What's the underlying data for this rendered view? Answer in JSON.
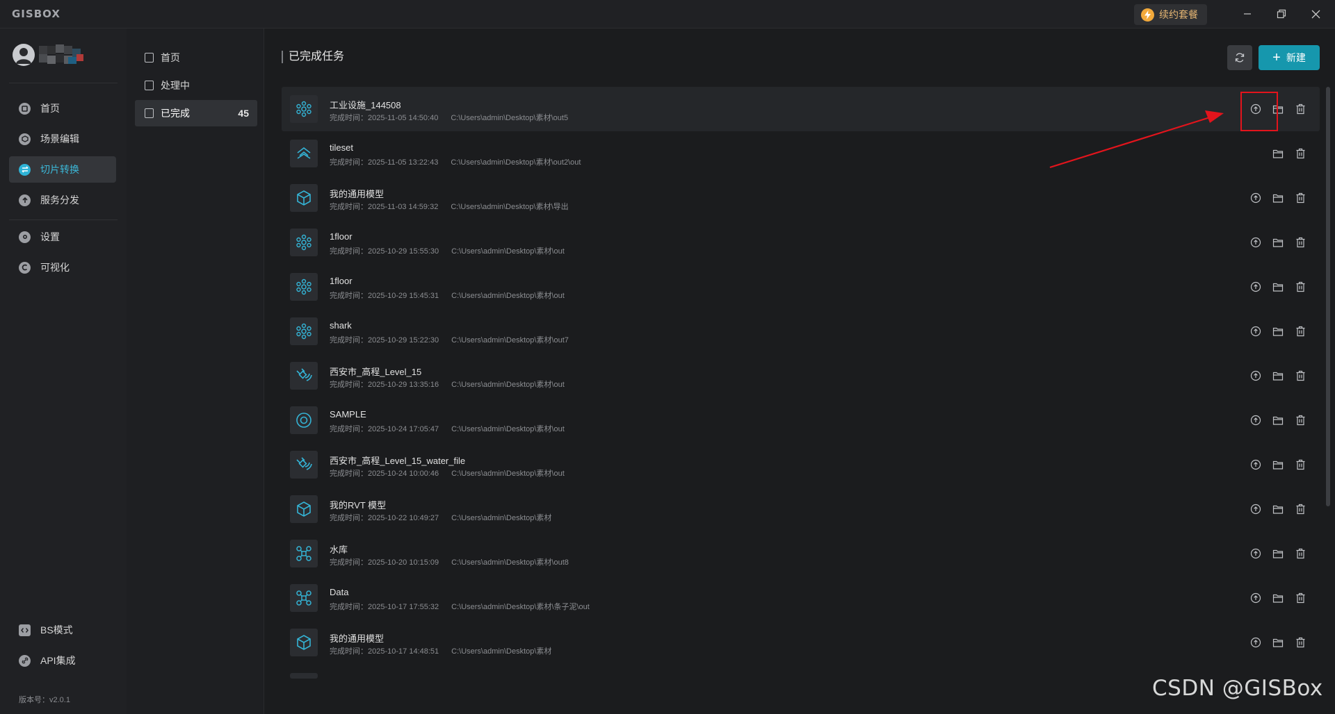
{
  "app": {
    "logo": "GISBOX",
    "renew_label": "续约套餐",
    "version": "版本号：v2.0.1"
  },
  "colors": {
    "accent": "#1697ad",
    "active_text": "#3cb8d8",
    "annotation_red": "#e3141c"
  },
  "sidebar": {
    "items": [
      {
        "label": "首页",
        "icon": "home-icon"
      },
      {
        "label": "场景编辑",
        "icon": "cube-icon"
      },
      {
        "label": "切片转换",
        "icon": "swap-icon"
      },
      {
        "label": "服务分发",
        "icon": "upload-icon"
      },
      {
        "label": "设置",
        "icon": "gear-icon"
      },
      {
        "label": "可视化",
        "icon": "chart-icon"
      }
    ],
    "bottom": [
      {
        "label": "BS模式",
        "icon": "code-icon"
      },
      {
        "label": "API集成",
        "icon": "link-icon"
      }
    ]
  },
  "subnav": {
    "items": [
      {
        "label": "首页"
      },
      {
        "label": "处理中"
      },
      {
        "label": "已完成",
        "count": "45"
      }
    ]
  },
  "main": {
    "title": "已完成任务",
    "new_label": "新建",
    "time_prefix": "完成时间："
  },
  "tasks": [
    {
      "name": "工业设施_144508",
      "time": "完成时间：2025-11-05 14:50:40",
      "path": "C:\\Users\\admin\\Desktop\\素材\\out5",
      "icon": "point-cloud-icon",
      "upload": true
    },
    {
      "name": "tileset",
      "time": "完成时间：2025-11-05 13:22:43",
      "path": "C:\\Users\\admin\\Desktop\\素材\\out2\\out",
      "icon": "tileset-icon",
      "upload": false
    },
    {
      "name": "我的通用模型",
      "time": "完成时间：2025-11-03 14:59:32",
      "path": "C:\\Users\\admin\\Desktop\\素材\\导出",
      "icon": "box-icon",
      "upload": true
    },
    {
      "name": "1floor",
      "time": "完成时间：2025-10-29 15:55:30",
      "path": "C:\\Users\\admin\\Desktop\\素材\\out",
      "icon": "point-cloud-icon",
      "upload": true
    },
    {
      "name": "1floor",
      "time": "完成时间：2025-10-29 15:45:31",
      "path": "C:\\Users\\admin\\Desktop\\素材\\out",
      "icon": "point-cloud-icon",
      "upload": true
    },
    {
      "name": "shark",
      "time": "完成时间：2025-10-29 15:22:30",
      "path": "C:\\Users\\admin\\Desktop\\素材\\out7",
      "icon": "point-cloud-icon",
      "upload": true
    },
    {
      "name": "西安市_高程_Level_15",
      "time": "完成时间：2025-10-29 13:35:16",
      "path": "C:\\Users\\admin\\Desktop\\素材\\out",
      "icon": "satellite-icon",
      "upload": true
    },
    {
      "name": "SAMPLE",
      "time": "完成时间：2025-10-24 17:05:47",
      "path": "C:\\Users\\admin\\Desktop\\素材\\out",
      "icon": "target-icon",
      "upload": true
    },
    {
      "name": "西安市_高程_Level_15_water_file",
      "time": "完成时间：2025-10-24 10:00:46",
      "path": "C:\\Users\\admin\\Desktop\\素材\\out",
      "icon": "satellite-icon",
      "upload": true
    },
    {
      "name": "我的RVT 模型",
      "time": "完成时间：2025-10-22 10:49:27",
      "path": "C:\\Users\\admin\\Desktop\\素材",
      "icon": "box-icon",
      "upload": true
    },
    {
      "name": "水库",
      "time": "完成时间：2025-10-20 10:15:09",
      "path": "C:\\Users\\admin\\Desktop\\素材\\out8",
      "icon": "network-icon",
      "upload": true
    },
    {
      "name": "Data",
      "time": "完成时间：2025-10-17 17:55:32",
      "path": "C:\\Users\\admin\\Desktop\\素材\\条子泥\\out",
      "icon": "network-icon",
      "upload": true
    },
    {
      "name": "我的通用模型",
      "time": "完成时间：2025-10-17 14:48:51",
      "path": "C:\\Users\\admin\\Desktop\\素材",
      "icon": "box-icon",
      "upload": true
    }
  ],
  "watermark": "CSDN @GISBox"
}
